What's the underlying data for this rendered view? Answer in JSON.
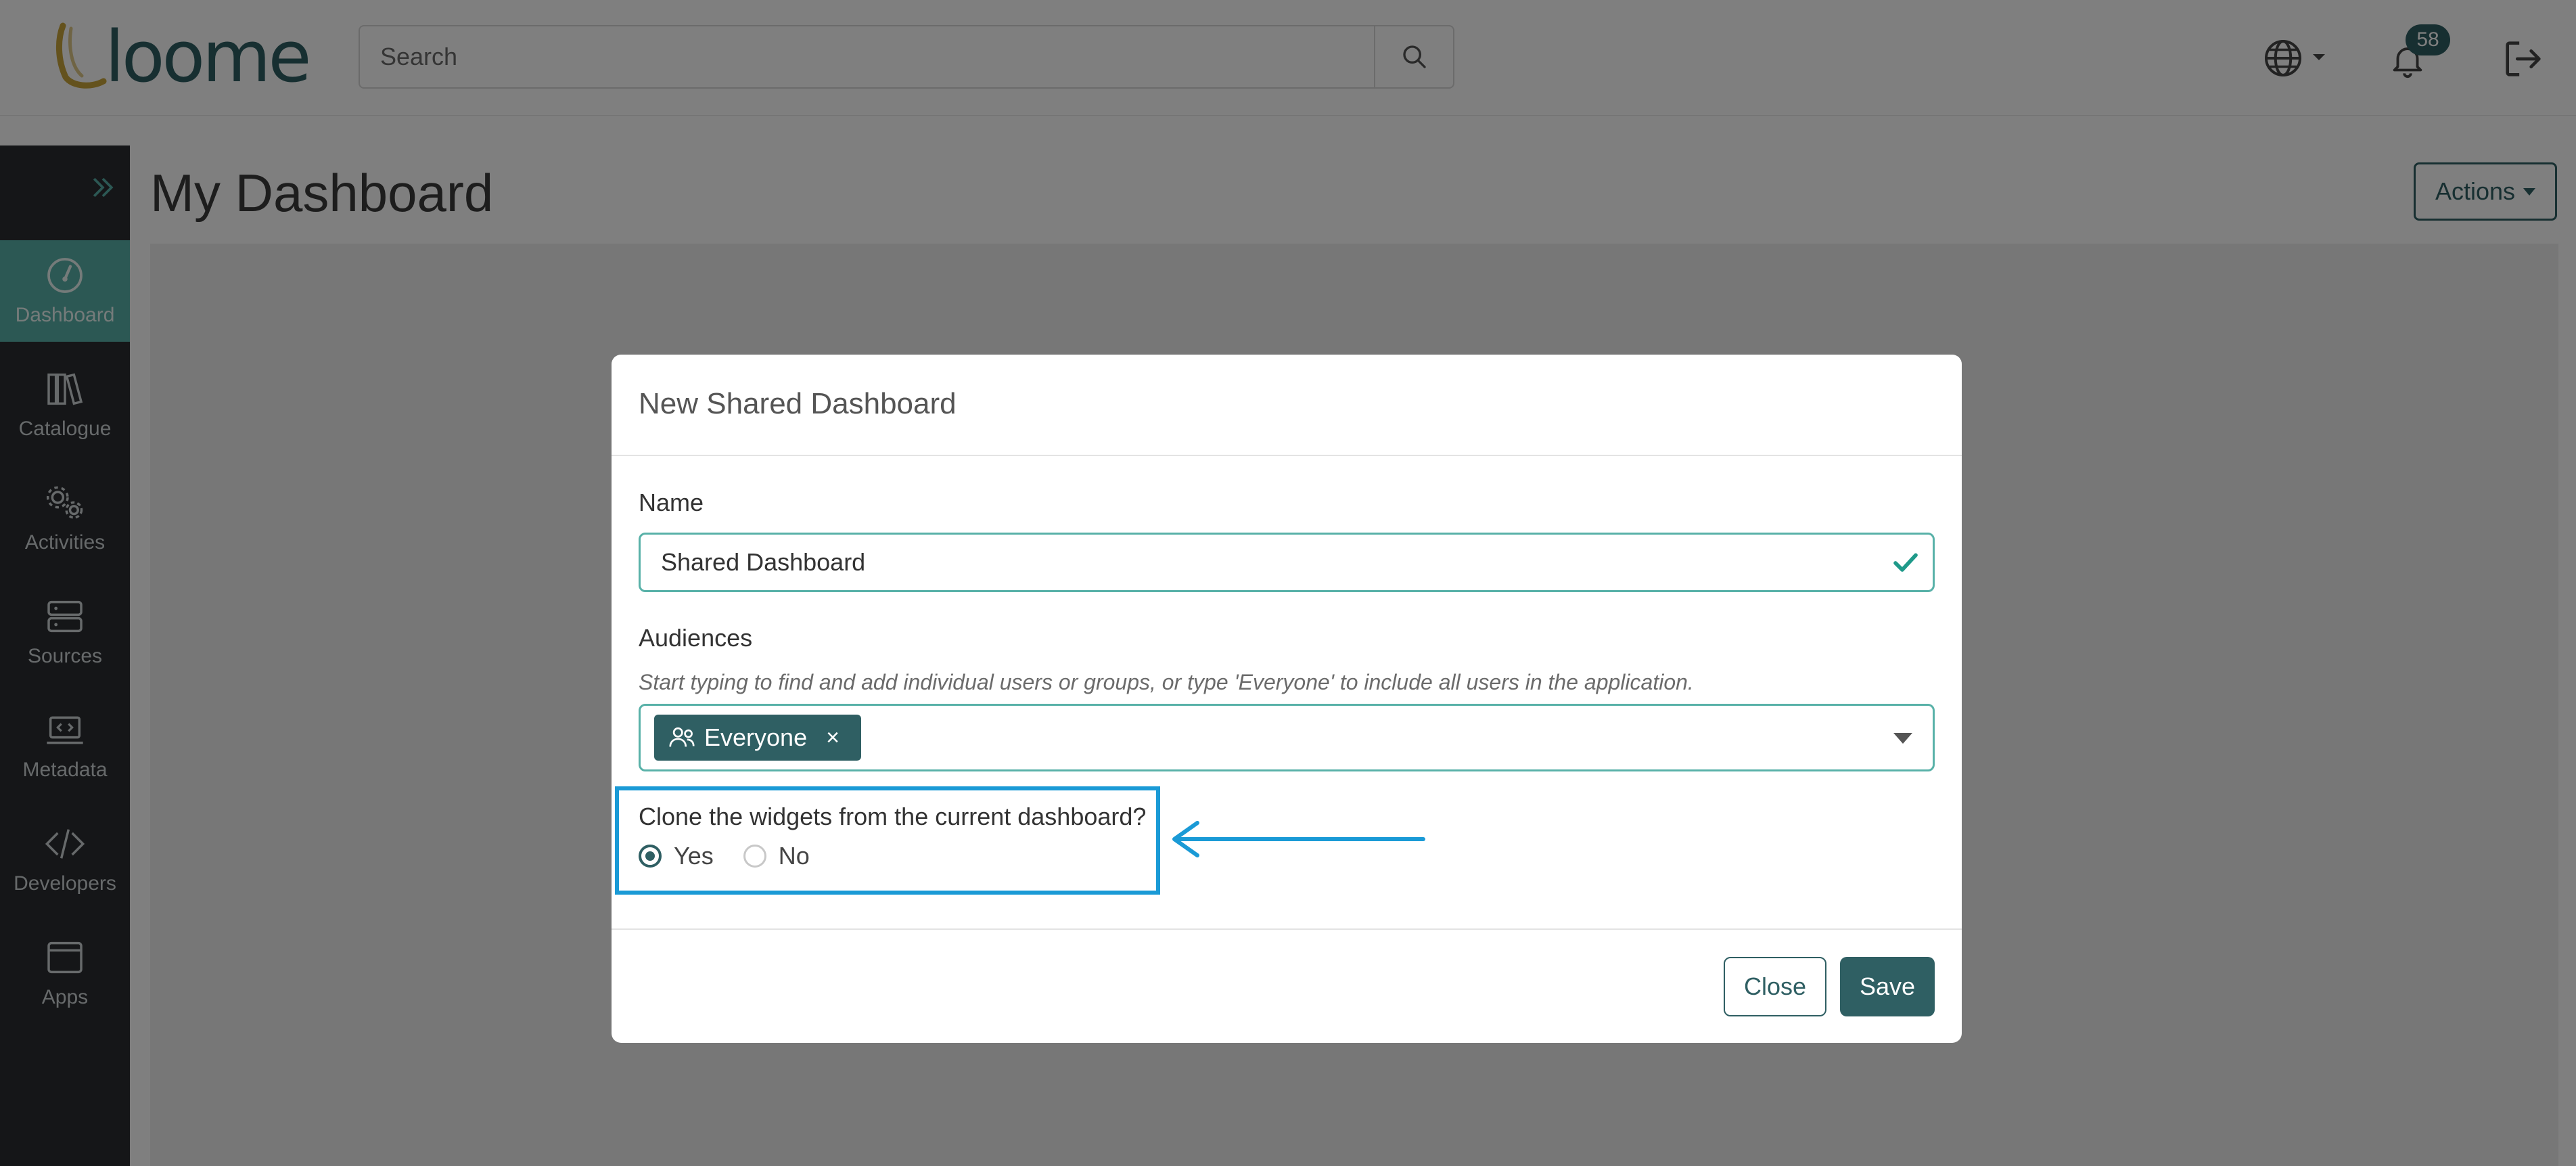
{
  "app": {
    "logo_text": "loome"
  },
  "header": {
    "search": {
      "placeholder": "Search",
      "value": ""
    },
    "notifications": {
      "count": "58"
    },
    "icons": [
      "globe-icon",
      "chevron-down-icon",
      "bell-icon",
      "logout-icon",
      "search-icon"
    ]
  },
  "sidebar": {
    "items": [
      {
        "label": "Dashboard",
        "icon": "gauge-icon",
        "active": true
      },
      {
        "label": "Catalogue",
        "icon": "books-icon",
        "active": false
      },
      {
        "label": "Activities",
        "icon": "gears-icon",
        "active": false
      },
      {
        "label": "Sources",
        "icon": "server-icon",
        "active": false
      },
      {
        "label": "Metadata",
        "icon": "laptop-code-icon",
        "active": false
      },
      {
        "label": "Developers",
        "icon": "code-icon",
        "active": false
      },
      {
        "label": "Apps",
        "icon": "window-icon",
        "active": false
      }
    ]
  },
  "main": {
    "title": "My Dashboard",
    "actions_label": "Actions"
  },
  "modal": {
    "title": "New Shared Dashboard",
    "name_label": "Name",
    "name_value": "Shared Dashboard",
    "audiences_label": "Audiences",
    "audiences_hint": "Start typing to find and add individual users or groups, or type 'Everyone' to include all users in the application.",
    "audience_tag": "Everyone",
    "audience_tag_remove": "×",
    "clone_question": "Clone the widgets from the current dashboard?",
    "clone_options": [
      {
        "label": "Yes",
        "selected": true
      },
      {
        "label": "No",
        "selected": false
      }
    ],
    "close_label": "Close",
    "save_label": "Save"
  },
  "colors": {
    "brand_teal": "#2f5f63",
    "accent_teal": "#58b1a8",
    "sidebar_bg": "#2b2d31",
    "highlight_blue": "#1a9ad6"
  }
}
